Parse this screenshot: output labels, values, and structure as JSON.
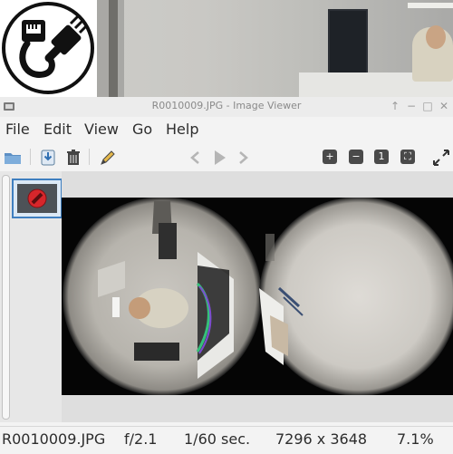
{
  "window": {
    "title": "R0010009.JPG - Image Viewer",
    "controls": {
      "up": "↑",
      "minimize": "−",
      "maximize": "□",
      "close": "✕"
    }
  },
  "menu": {
    "items": [
      {
        "label": "File"
      },
      {
        "label": "Edit"
      },
      {
        "label": "View"
      },
      {
        "label": "Go"
      },
      {
        "label": "Help"
      }
    ]
  },
  "toolbar": {
    "zoom_in": "+",
    "zoom_out": "−",
    "zoom_original": "1",
    "zoom_fit": "⛶"
  },
  "status": {
    "filename": "R0010009.JPG",
    "aperture": "f/2.1",
    "exposure": "1/60 sec.",
    "dimensions": "7296 x 3648",
    "zoom": "7.1%"
  },
  "icons": {
    "open": "folder-open-icon",
    "save": "save-icon",
    "delete": "trash-icon",
    "edit": "pencil-icon",
    "prev": "arrow-left-icon",
    "play": "play-icon",
    "next": "arrow-right-icon",
    "fullscreen": "fullscreen-icon",
    "thumb_broken": "no-entry-icon",
    "logo": "ethernet-cable-icon"
  },
  "colors": {
    "accent": "#3f7fc0",
    "no_entry": "#d7262b",
    "image_bg": "#050505"
  }
}
